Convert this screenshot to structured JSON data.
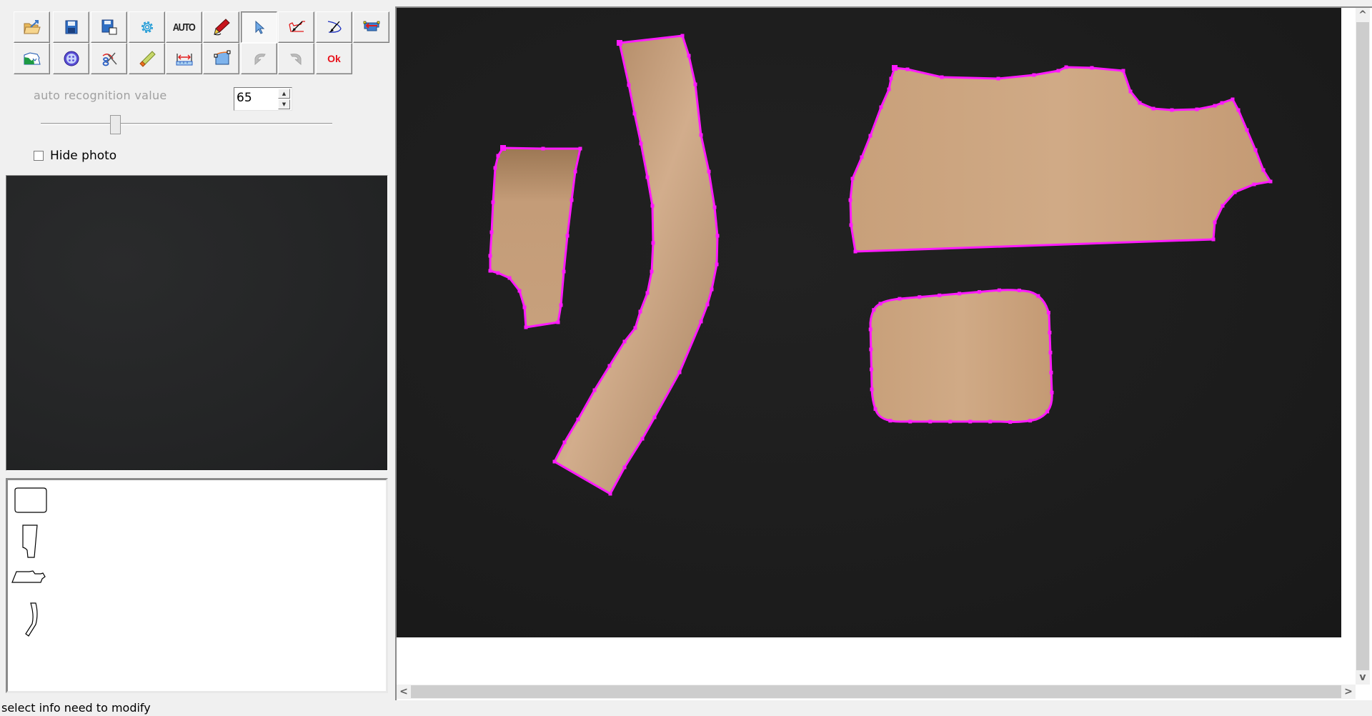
{
  "toolbar": {
    "row1": [
      {
        "name": "open-image-button",
        "icon": "folder-open-icon",
        "tooltip": "open"
      },
      {
        "name": "save-button",
        "icon": "floppy-disk-icon"
      },
      {
        "name": "save-as-button",
        "icon": "floppy-disk-page-icon"
      },
      {
        "name": "settings-button",
        "icon": "gear-icon"
      },
      {
        "name": "auto-button",
        "label": "AUTO"
      },
      {
        "name": "draw-pen-button",
        "icon": "pen-icon"
      },
      {
        "name": "select-button",
        "icon": "arrow-cursor-icon",
        "active": true
      },
      {
        "name": "add-point-button",
        "icon": "compass-red-icon"
      },
      {
        "name": "arc-button",
        "icon": "compass-blue-icon"
      },
      {
        "name": "move-piece-button",
        "icon": "piece-arrow-icon"
      }
    ],
    "row2": [
      {
        "name": "map-image-button",
        "icon": "map-icon"
      },
      {
        "name": "button-tool-button",
        "icon": "button-icon"
      },
      {
        "name": "cut-button",
        "icon": "scissors-icon"
      },
      {
        "name": "eraser-button",
        "icon": "eraser-icon"
      },
      {
        "name": "measure-button",
        "icon": "ruler-icon"
      },
      {
        "name": "curve-button",
        "icon": "bezier-icon"
      },
      {
        "name": "undo-button",
        "icon": "undo-icon",
        "disabled": true
      },
      {
        "name": "redo-button",
        "icon": "redo-icon",
        "disabled": true
      },
      {
        "name": "ok-button",
        "label": "Ok"
      }
    ]
  },
  "recognition": {
    "label": "auto recognition value",
    "value": "65",
    "slider_min": 0,
    "slider_max": 255,
    "slider_value": 65
  },
  "hide_photo": {
    "label": "Hide photo",
    "checked": false
  },
  "pieces_list": [
    {
      "name": "rounded-rectangle-piece"
    },
    {
      "name": "small-trouser-piece"
    },
    {
      "name": "bodice-piece"
    },
    {
      "name": "curved-strip-piece"
    }
  ],
  "canvas": {
    "outline_color": "#ff1aff",
    "piece_fill": "#c9a07a",
    "background": "#1c1c1c"
  },
  "scrollbars": {
    "up": "^",
    "down": "v",
    "left": "<",
    "right": ">"
  },
  "status": {
    "text": "select info need to modify"
  }
}
